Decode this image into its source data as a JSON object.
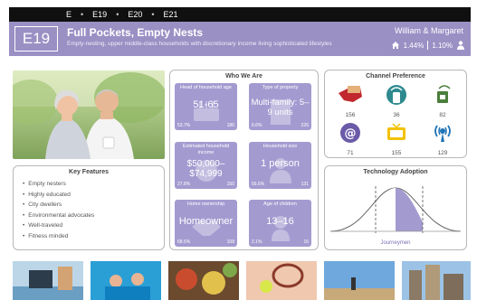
{
  "breadcrumb": [
    "E",
    "E19",
    "E20",
    "E21"
  ],
  "header": {
    "code": "E19",
    "title": "Full Pockets, Empty Nests",
    "subtitle": "Empty-nesting, upper middle-class households with discretionary income living sophisticated lifestyles",
    "name": "William & Margaret",
    "stat1": "1.44%",
    "stat2": "1.10%"
  },
  "features": {
    "title": "Key Features",
    "items": [
      "Empty nesters",
      "Highly educated",
      "City dwellers",
      "Environmental advocates",
      "Well-traveled",
      "Fitness minded"
    ]
  },
  "who": {
    "title": "Who We Are",
    "tiles": [
      {
        "label": "Head of household age",
        "value": "51-65",
        "pct": "53.7%",
        "idx": "186"
      },
      {
        "label": "Type of property",
        "value": "Multi-family: 5–9 units",
        "pct": "6.6%",
        "idx": "226"
      },
      {
        "label": "Estimated household income",
        "value": "$50,000–$74,999",
        "pct": "27.8%",
        "idx": "150"
      },
      {
        "label": "Household size",
        "value": "1 person",
        "pct": "56.6%",
        "idx": "131"
      },
      {
        "label": "Home ownership",
        "value": "Homeowner",
        "pct": "68.5%",
        "idx": "108"
      },
      {
        "label": "Age of children",
        "value": "13–16",
        "pct": "2.1%",
        "idx": "16"
      }
    ]
  },
  "channel": {
    "title": "Channel Preference",
    "items": [
      {
        "icon": "direct-mail-icon",
        "value": "156"
      },
      {
        "icon": "mobile-icon",
        "value": "36"
      },
      {
        "icon": "broadband-icon",
        "value": "82"
      },
      {
        "icon": "email-icon",
        "value": "71"
      },
      {
        "icon": "tv-icon",
        "value": "155"
      },
      {
        "icon": "radio-icon",
        "value": "129"
      }
    ]
  },
  "tech": {
    "title": "Technology Adoption",
    "label": "Journeymen"
  },
  "colors": {
    "accent": "#9a90c4",
    "tile": "#a39bd0",
    "channel_red": "#c0282e",
    "channel_teal": "#2e8a8f",
    "channel_green": "#4a7f3c",
    "channel_purple": "#6a5aa8",
    "channel_yellow": "#f2c200",
    "channel_blue": "#1e74b8"
  }
}
